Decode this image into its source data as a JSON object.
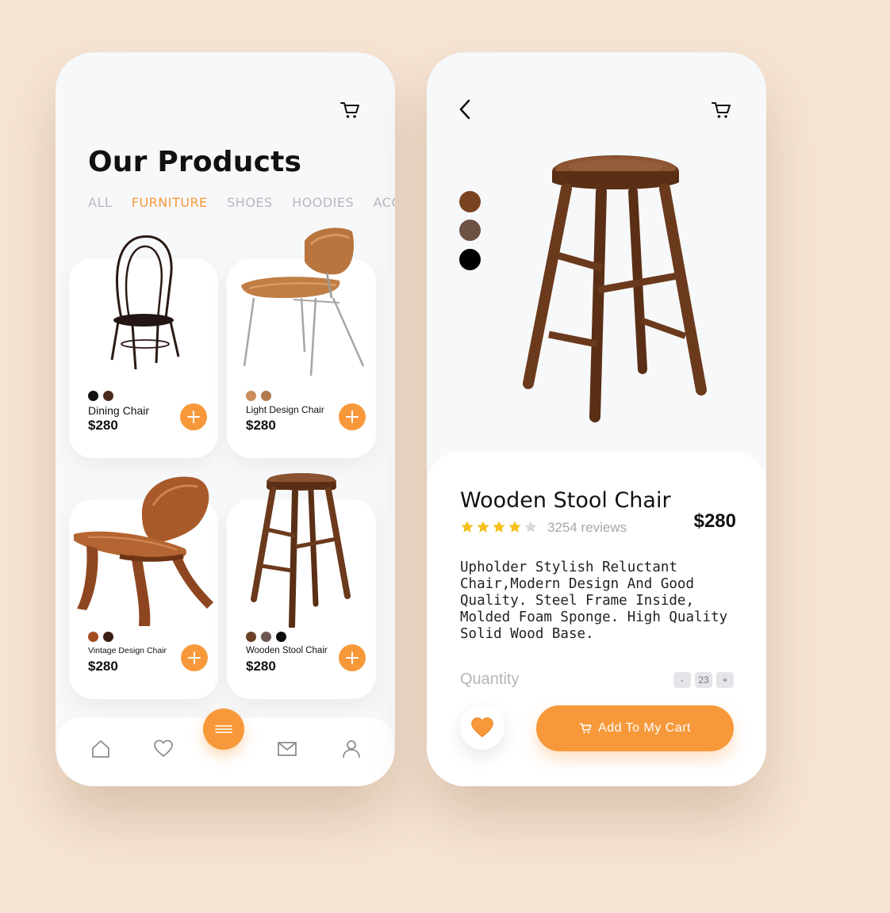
{
  "colors": {
    "accent": "#f7993a",
    "background": "#f6e4d4"
  },
  "list_screen": {
    "title": "Our Products",
    "cart_icon": "cart-icon",
    "tabs": [
      {
        "label": "ALL",
        "active": false
      },
      {
        "label": "FURNITURE",
        "active": true
      },
      {
        "label": "SHOES",
        "active": false
      },
      {
        "label": "HOODIES",
        "active": false
      },
      {
        "label": "ACCESSORIES",
        "active": false
      }
    ],
    "products": [
      {
        "name": "Dining Chair",
        "price": "$280",
        "swatches": [
          "#111111",
          "#4a2a1c"
        ]
      },
      {
        "name": "Light Design Chair",
        "price": "$280",
        "swatches": [
          "#c98e5b",
          "#b07a4f"
        ]
      },
      {
        "name": "Vintage Design Chair",
        "price": "$280",
        "swatches": [
          "#a44a21",
          "#3a1f14"
        ]
      },
      {
        "name": "Wooden Stool Chair",
        "price": "$280",
        "swatches": [
          "#6b4024",
          "#6b5650",
          "#0d0d0d"
        ]
      }
    ],
    "nav": [
      "home-icon",
      "heart-icon",
      "menu-icon",
      "mail-icon",
      "user-icon"
    ]
  },
  "detail_screen": {
    "color_options": [
      "#7a4320",
      "#6d5144",
      "#000000"
    ],
    "name": "Wooden Stool Chair",
    "rating": 4,
    "reviews": "3254 reviews",
    "price": "$280",
    "description": "Upholder Stylish Reluctant Chair,Modern Design And Good Quality. Steel Frame Inside, Molded Foam Sponge. High Quality Solid Wood Base.",
    "quantity_label": "Quantity",
    "qty_minus": "-",
    "qty_value": "23",
    "qty_plus": "+",
    "add_to_cart": "Add To My Cart"
  }
}
